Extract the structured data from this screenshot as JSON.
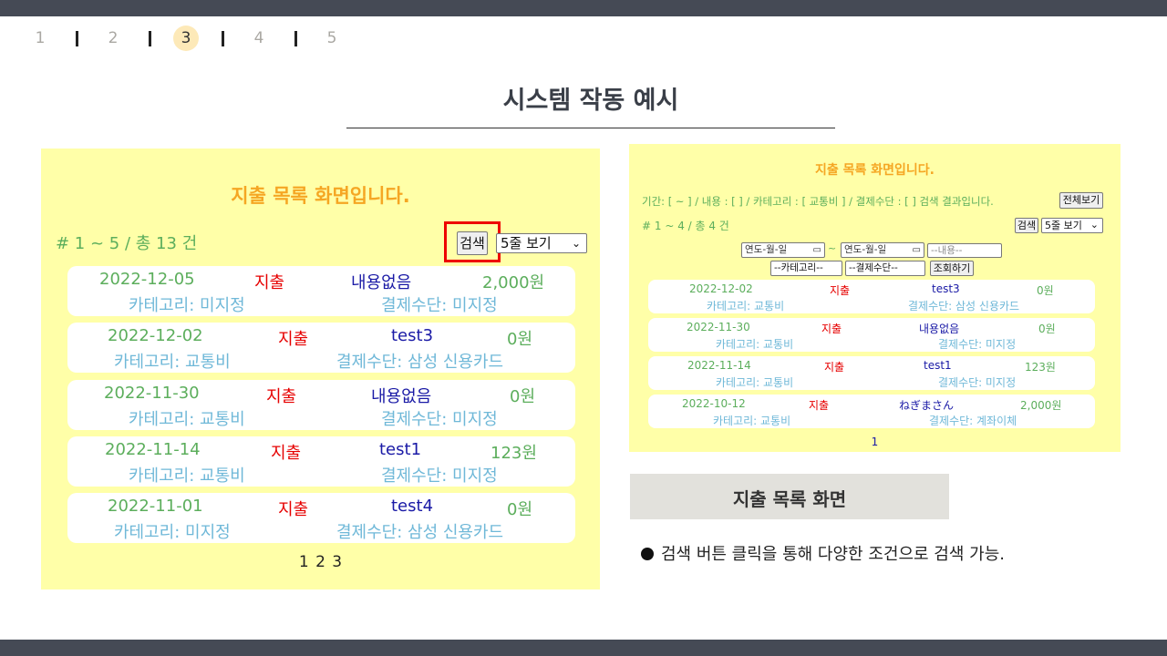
{
  "pager": {
    "pages": [
      "1",
      "2",
      "3",
      "4",
      "5"
    ],
    "active": "3"
  },
  "title": "시스템 작동 예시",
  "left_panel": {
    "heading": "지출 목록 화면입니다.",
    "count_text": "# 1 ~ 5 / 총 13 건",
    "search_label": "검색",
    "view_select": "5줄 보기",
    "entries": [
      {
        "date": "2022-12-05",
        "kind": "지출",
        "memo": "내용없음",
        "amount": "2,000원",
        "category": "카테고리: 미지정",
        "payment": "결제수단: 미지정"
      },
      {
        "date": "2022-12-02",
        "kind": "지출",
        "memo": "test3",
        "amount": "0원",
        "category": "카테고리: 교통비",
        "payment": "결제수단: 삼성 신용카드"
      },
      {
        "date": "2022-11-30",
        "kind": "지출",
        "memo": "내용없음",
        "amount": "0원",
        "category": "카테고리: 교통비",
        "payment": "결제수단: 미지정"
      },
      {
        "date": "2022-11-14",
        "kind": "지출",
        "memo": "test1",
        "amount": "123원",
        "category": "카테고리: 교통비",
        "payment": "결제수단: 미지정"
      },
      {
        "date": "2022-11-01",
        "kind": "지출",
        "memo": "test4",
        "amount": "0원",
        "category": "카테고리: 미지정",
        "payment": "결제수단: 삼성 신용카드"
      }
    ],
    "pages": "1 2 3"
  },
  "right_panel": {
    "heading": "지출 목록 화면입니다.",
    "condition_text": "기간: [ ~ ] / 내용 : [ ] / 카테고리 : [ 교통비 ] / 결제수단 : [ ] 검색 결과입니다.",
    "view_all_label": "전체보기",
    "count_text": "# 1 ~ 4 / 총 4 건",
    "search_label": "검색",
    "view_select": "5줄 보기",
    "date_from_placeholder": "연도-월-일",
    "date_to_placeholder": "연도-월-일",
    "tilde": "~",
    "memo_placeholder": "--내용--",
    "category_select": "--카테고리--",
    "payment_select": "--결제수단--",
    "lookup_label": "조회하기",
    "entries": [
      {
        "date": "2022-12-02",
        "kind": "지출",
        "memo": "test3",
        "amount": "0원",
        "category": "카테고리: 교통비",
        "payment": "결제수단: 삼성 신용카드"
      },
      {
        "date": "2022-11-30",
        "kind": "지출",
        "memo": "내용없음",
        "amount": "0원",
        "category": "카테고리: 교통비",
        "payment": "결제수단: 미지정"
      },
      {
        "date": "2022-11-14",
        "kind": "지출",
        "memo": "test1",
        "amount": "123원",
        "category": "카테고리: 교통비",
        "payment": "결제수단: 미지정"
      },
      {
        "date": "2022-10-12",
        "kind": "지출",
        "memo": "ねぎまさん",
        "amount": "2,000원",
        "category": "카테고리: 교통비",
        "payment": "결제수단: 계좌이체"
      }
    ],
    "pages": "1"
  },
  "caption": "지출 목록 화면",
  "bullet_text": "검색 버튼 클릭을 통해 다양한 조건으로 검색 가능.",
  "colors": {
    "panel_bg": "#ffffa8",
    "heading": "#f5a623",
    "date": "#5cae5c",
    "kind": "#e60000",
    "memo": "#1a1aa6",
    "meta": "#6fb8d8",
    "highlight": "#ee0000",
    "bars": "#454a55"
  }
}
